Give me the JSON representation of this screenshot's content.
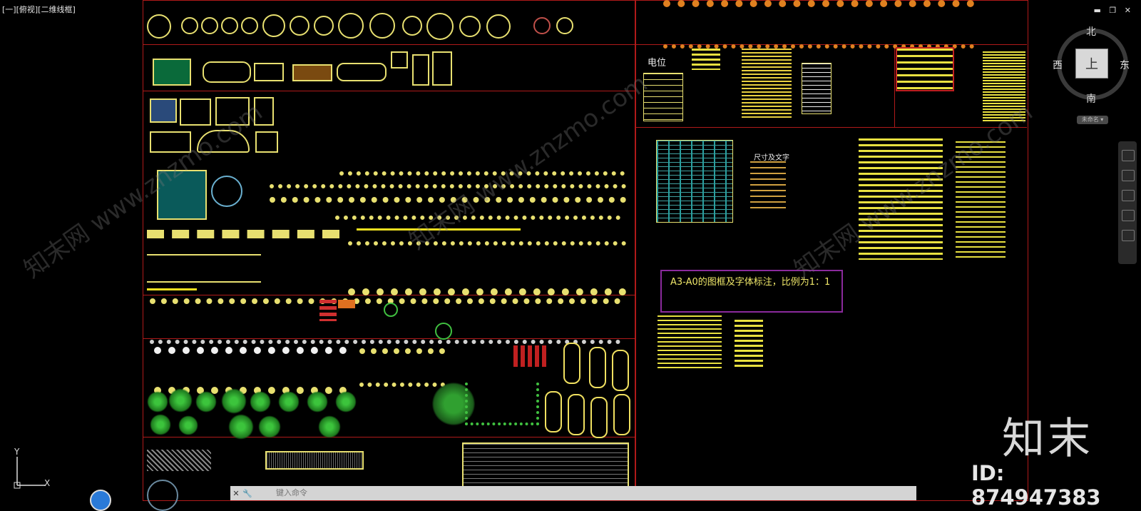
{
  "viewport": {
    "label": "[一][俯视][二维线框]"
  },
  "window_controls": {
    "minimize": "▬",
    "restore": "❐",
    "close": "✕"
  },
  "viewcube": {
    "north": "北",
    "south": "南",
    "east": "东",
    "west": "西",
    "face": "上",
    "wcs_menu": "未命名 ▾"
  },
  "drawing": {
    "label_dianwei": "电位",
    "label_size_text": "尺寸及文字",
    "note_title": "A3-A0的图框及字体标注，比例为1：1"
  },
  "ucs": {
    "x": "X",
    "y": "Y"
  },
  "command_line": {
    "placeholder": "键入命令",
    "close_icon": "✕",
    "customize_icon": "🔧"
  },
  "brand": {
    "name": "知末",
    "id_text": "ID: 874947383",
    "watermark": "知末网 www.znzmo.com"
  },
  "colors": {
    "background": "#000000",
    "frame_red": "#b01a1a",
    "cad_yellow": "#e8e84a",
    "note_purple": "#8a2a9c"
  }
}
